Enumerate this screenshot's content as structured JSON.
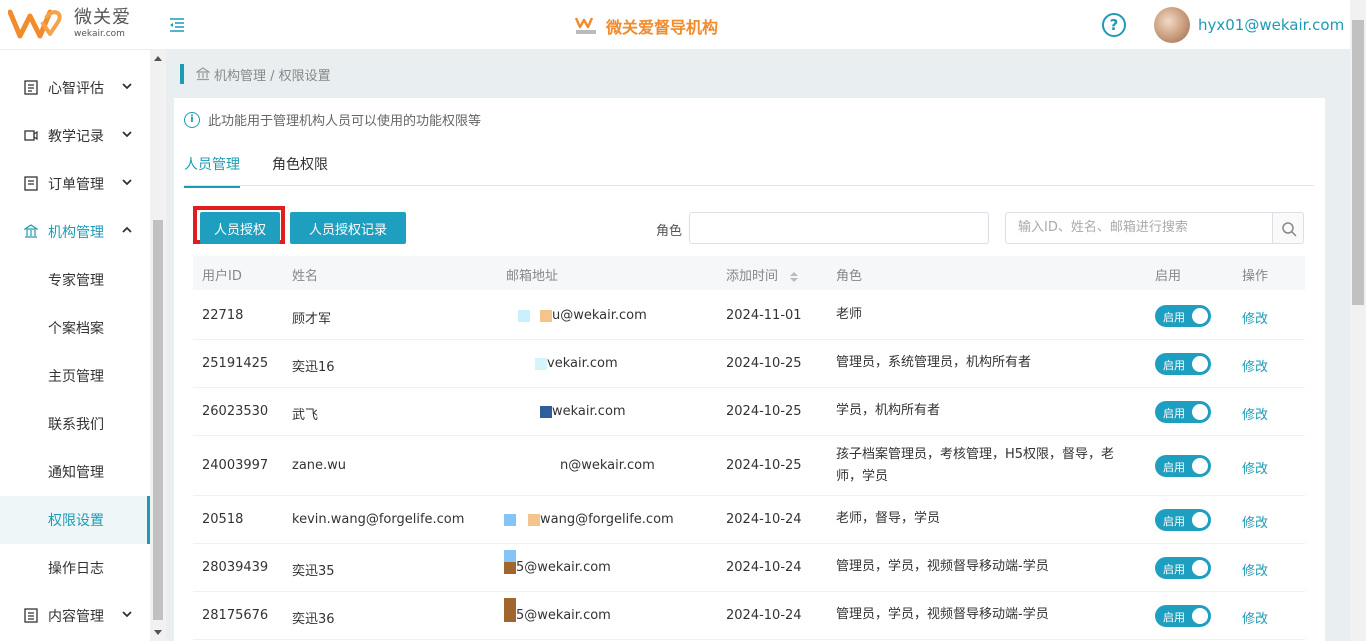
{
  "header": {
    "logo_cn": "微关爱",
    "logo_en": "wekair.com",
    "org_name": "微关爱督导机构",
    "help_symbol": "?",
    "user_email": "hyx01@wekair.com"
  },
  "sidebar": {
    "items": [
      {
        "label": "心智评估",
        "icon": "report-icon",
        "expandable": true,
        "expanded": false
      },
      {
        "label": "教学记录",
        "icon": "video-icon",
        "expandable": true,
        "expanded": false
      },
      {
        "label": "订单管理",
        "icon": "order-icon",
        "expandable": true,
        "expanded": false
      },
      {
        "label": "机构管理",
        "icon": "bank-icon",
        "expandable": true,
        "expanded": true
      },
      {
        "label": "专家管理"
      },
      {
        "label": "个案档案"
      },
      {
        "label": "主页管理"
      },
      {
        "label": "联系我们"
      },
      {
        "label": "通知管理"
      },
      {
        "label": "权限设置",
        "selected": true
      },
      {
        "label": "操作日志"
      },
      {
        "label": "内容管理",
        "icon": "content-icon",
        "expandable": true,
        "expanded": false
      }
    ]
  },
  "breadcrumb": "机构管理 / 权限设置",
  "info_text": "此功能用于管理机构人员可以使用的功能权限等",
  "tabs": [
    {
      "label": "人员管理",
      "active": true
    },
    {
      "label": "角色权限",
      "active": false
    }
  ],
  "buttons": {
    "authorize": "人员授权",
    "auth_log": "人员授权记录"
  },
  "filters": {
    "role_label": "角色",
    "role_value": "",
    "search_placeholder": "输入ID、姓名、邮箱进行搜索"
  },
  "table": {
    "columns": [
      "用户ID",
      "姓名",
      "邮箱地址",
      "添加时间",
      "角色",
      "启用",
      "操作"
    ],
    "rows": [
      {
        "id": "22718",
        "name": "顾才军",
        "email": "u@wekair.com",
        "date": "2024-11-01",
        "roles": "老师",
        "enabled": "启用",
        "action": "修改"
      },
      {
        "id": "25191425",
        "name": "奕迅16",
        "email": "vekair.com",
        "date": "2024-10-25",
        "roles": "管理员，系统管理员，机构所有者",
        "enabled": "启用",
        "action": "修改"
      },
      {
        "id": "26023530",
        "name": "武飞",
        "email": "wekair.com",
        "date": "2024-10-25",
        "roles": "学员，机构所有者",
        "enabled": "启用",
        "action": "修改"
      },
      {
        "id": "24003997",
        "name": "zane.wu",
        "email": "n@wekair.com",
        "date": "2024-10-25",
        "roles": "孩子档案管理员，考核管理，H5权限，督导，老师，学员",
        "enabled": "启用",
        "action": "修改"
      },
      {
        "id": "20518",
        "name": "kevin.wang@forgelife.com",
        "email": "wang@forgelife.com",
        "date": "2024-10-24",
        "roles": "老师，督导，学员",
        "enabled": "启用",
        "action": "修改"
      },
      {
        "id": "28039439",
        "name": "奕迅35",
        "email": "5@wekair.com",
        "date": "2024-10-24",
        "roles": "管理员，学员，视频督导移动端-学员",
        "enabled": "启用",
        "action": "修改"
      },
      {
        "id": "28175676",
        "name": "奕迅36",
        "email": "5@wekair.com",
        "date": "2024-10-24",
        "roles": "管理员，学员，视频督导移动端-学员",
        "enabled": "启用",
        "action": "修改"
      }
    ]
  },
  "colors": {
    "accent": "#1d9bb5",
    "button": "#1f9fbf",
    "brand_orange": "#f28b2c",
    "highlight_red": "#e01e1e"
  }
}
